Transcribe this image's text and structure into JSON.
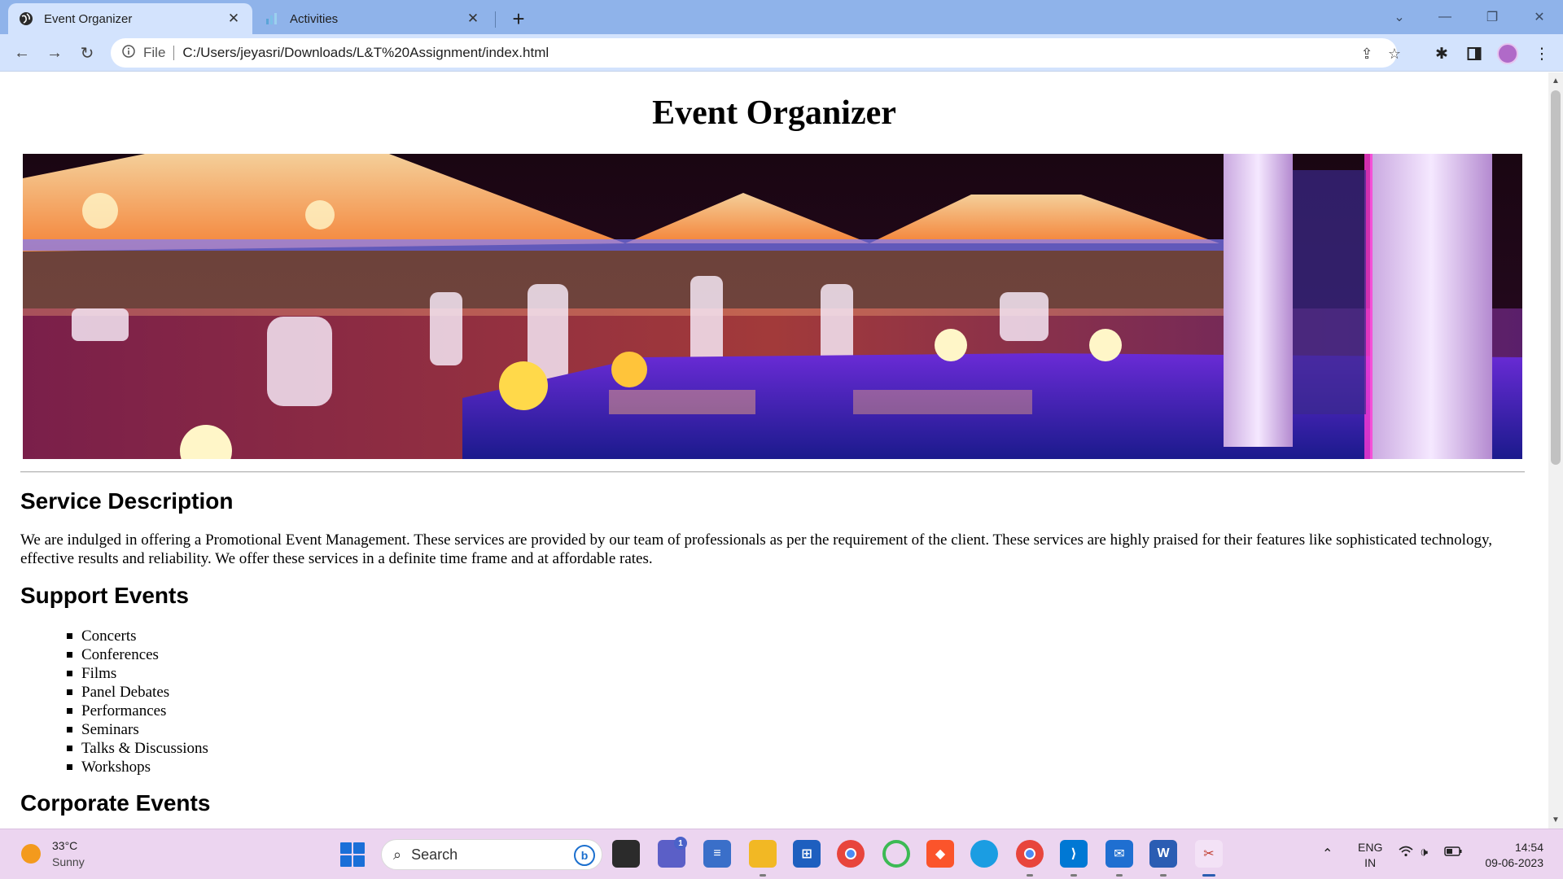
{
  "browser": {
    "tabs": [
      {
        "title": "Event Organizer",
        "active": true
      },
      {
        "title": "Activities",
        "active": false
      }
    ],
    "address": {
      "scheme_label": "File",
      "url": "C:/Users/jeyasri/Downloads/L&T%20Assignment/index.html"
    }
  },
  "page": {
    "title": "Event Organizer",
    "service_heading": "Service Description",
    "service_text": "We are indulged in offering a Promotional Event Management. These services are provided by our team of professionals as per the requirement of the client. These services are highly praised for their features like sophisticated technology, effective results and reliability. We offer these services in a definite time frame and at affordable rates.",
    "support_heading": "Support Events",
    "support_events": [
      "Concerts",
      "Conferences",
      "Films",
      "Panel Debates",
      "Performances",
      "Seminars",
      "Talks & Discussions",
      "Workshops"
    ],
    "corporate_heading": "Corporate Events"
  },
  "taskbar": {
    "weather": {
      "temp": "33°C",
      "condition": "Sunny"
    },
    "search_label": "Search",
    "badge_count": "1",
    "lang": {
      "line1": "ENG",
      "line2": "IN"
    },
    "clock": {
      "time": "14:54",
      "date": "09-06-2023"
    }
  },
  "colors": {
    "tab_strip": "#8fb3ea",
    "toolbar": "#d3e3fd",
    "taskbar": "#ecd5f0"
  }
}
